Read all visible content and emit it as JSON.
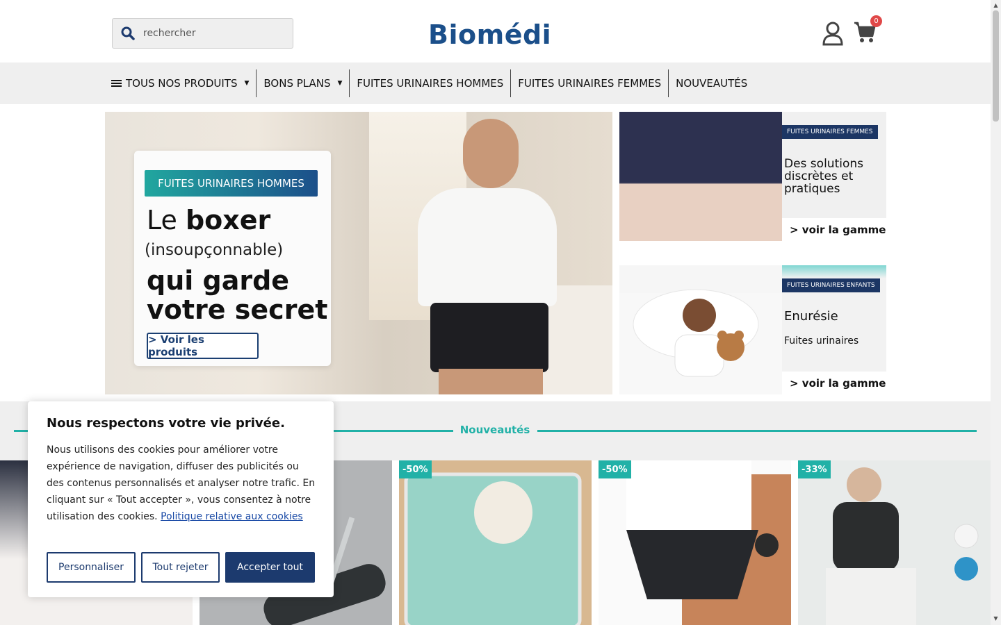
{
  "header": {
    "search_placeholder": "rechercher",
    "logo": "Biomédi",
    "cart_count": "0"
  },
  "nav": {
    "items": [
      {
        "label": "TOUS NOS PRODUITS",
        "has_menu": true
      },
      {
        "label": "BONS PLANS",
        "has_menu": true
      },
      {
        "label": "FUITES URINAIRES HOMMES"
      },
      {
        "label": "FUITES URINAIRES FEMMES"
      },
      {
        "label": "NOUVEAUTÉS"
      }
    ]
  },
  "hero": {
    "tag": "FUITES URINAIRES HOMMES",
    "line1_a": "Le ",
    "line1_b": "boxer",
    "line2": "(insoupçonnable)",
    "line3": "qui garde",
    "line4": "votre secret",
    "button": "> Voir les produits"
  },
  "banners": [
    {
      "tag": "FUITES URINAIRES FEMMES",
      "title_1": "Des solutions",
      "title_2": "discrètes et",
      "title_3": "pratiques",
      "link": "> voir la gamme"
    },
    {
      "tag": "FUITES URINAIRES ENFANTS",
      "title_1": "Enurésie",
      "title_2": "Fuites urinaires",
      "link": "> voir la gamme"
    }
  ],
  "nouveautes": {
    "title": "Nouveautés",
    "products": [
      {
        "discount": ""
      },
      {
        "discount": ""
      },
      {
        "discount": "-50%"
      },
      {
        "discount": "-50%"
      },
      {
        "discount": "-33%"
      }
    ]
  },
  "cookie": {
    "title": "Nous respectons votre vie privée.",
    "body": "Nous utilisons des cookies pour améliorer votre expérience de navigation, diffuser des publicités ou des contenus personnalisés et analyser notre trafic. En cliquant sur « Tout accepter », vous consentez à notre utilisation des cookies.",
    "link": "Politique relative aux cookies",
    "btn_customize": "Personnaliser",
    "btn_reject": "Tout rejeter",
    "btn_accept": "Accepter tout"
  },
  "colors": {
    "brand_blue": "#1b4f8a",
    "teal": "#21b1a7",
    "navy": "#1c3a6e",
    "badge_red": "#e04848"
  }
}
